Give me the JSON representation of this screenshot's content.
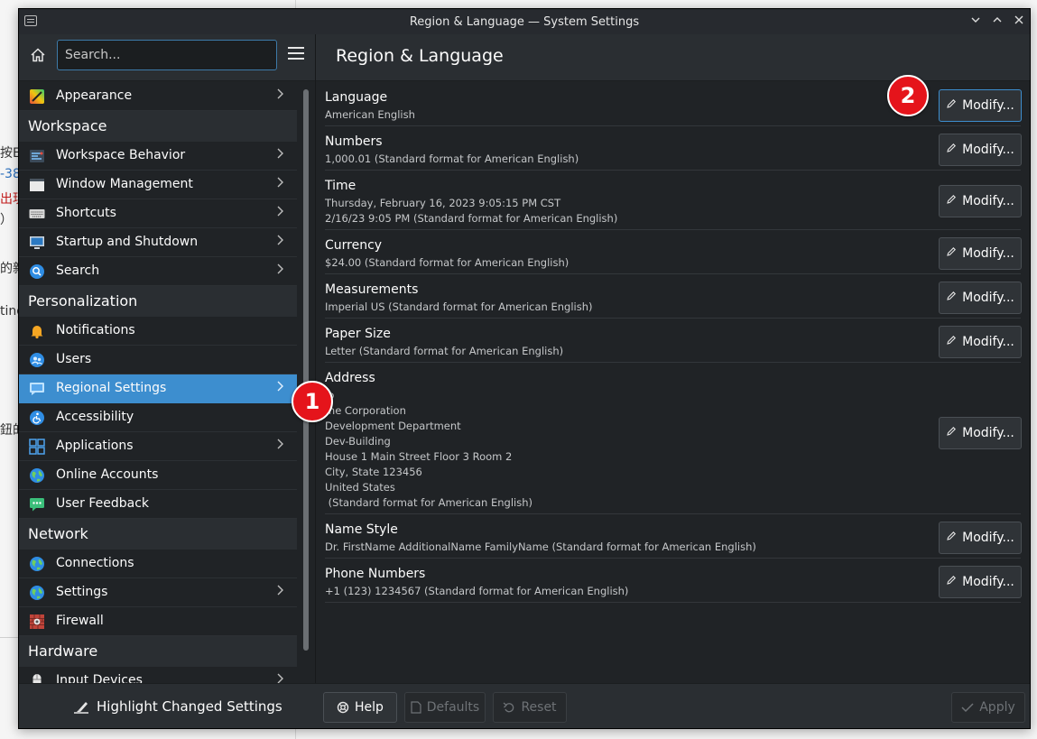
{
  "window": {
    "title": "Region & Language — System Settings"
  },
  "background_fragments": [
    "按E",
    "-38",
    "出現",
    "）",
    "的新",
    "ting",
    "鈕的"
  ],
  "search": {
    "placeholder": "Search..."
  },
  "sidebar": {
    "items": [
      {
        "type": "item",
        "label": "Appearance",
        "icon": "appearance-icon",
        "chevron": true
      },
      {
        "type": "header",
        "label": "Workspace"
      },
      {
        "type": "item",
        "label": "Workspace Behavior",
        "icon": "workspace-behavior-icon",
        "chevron": true
      },
      {
        "type": "item",
        "label": "Window Management",
        "icon": "window-management-icon",
        "chevron": true
      },
      {
        "type": "item",
        "label": "Shortcuts",
        "icon": "keyboard-icon",
        "chevron": true
      },
      {
        "type": "item",
        "label": "Startup and Shutdown",
        "icon": "monitor-icon",
        "chevron": true
      },
      {
        "type": "item",
        "label": "Search",
        "icon": "search-icon",
        "chevron": true
      },
      {
        "type": "header",
        "label": "Personalization"
      },
      {
        "type": "item",
        "label": "Notifications",
        "icon": "bell-icon",
        "chevron": false
      },
      {
        "type": "item",
        "label": "Users",
        "icon": "users-icon",
        "chevron": false
      },
      {
        "type": "item",
        "label": "Regional Settings",
        "icon": "regional-icon",
        "chevron": true,
        "active": true
      },
      {
        "type": "item",
        "label": "Accessibility",
        "icon": "accessibility-icon",
        "chevron": false
      },
      {
        "type": "item",
        "label": "Applications",
        "icon": "applications-icon",
        "chevron": true
      },
      {
        "type": "item",
        "label": "Online Accounts",
        "icon": "globe-icon",
        "chevron": false
      },
      {
        "type": "item",
        "label": "User Feedback",
        "icon": "feedback-icon",
        "chevron": false
      },
      {
        "type": "header",
        "label": "Network"
      },
      {
        "type": "item",
        "label": "Connections",
        "icon": "globe-icon",
        "chevron": false
      },
      {
        "type": "item",
        "label": "Settings",
        "icon": "globe-icon",
        "chevron": true
      },
      {
        "type": "item",
        "label": "Firewall",
        "icon": "firewall-icon",
        "chevron": false
      },
      {
        "type": "header",
        "label": "Hardware"
      },
      {
        "type": "item",
        "label": "Input Devices",
        "icon": "mouse-icon",
        "chevron": true
      }
    ]
  },
  "content": {
    "title": "Region & Language",
    "modify_label": "Modify...",
    "rows": [
      {
        "title": "Language",
        "sub": "American English"
      },
      {
        "title": "Numbers",
        "sub": "1,000.01 (Standard format for American English)"
      },
      {
        "title": "Time",
        "sub": "Thursday, February 16, 2023 9:05:15 PM CST\n2/16/23 9:05 PM (Standard format for American English)"
      },
      {
        "title": "Currency",
        "sub": "$24.00 (Standard format for American English)"
      },
      {
        "title": "Measurements",
        "sub": "Imperial US (Standard format for American English)"
      },
      {
        "title": "Paper Size",
        "sub": "Letter (Standard format for American English)"
      },
      {
        "title": "Address",
        "sub": "Jo\nme Corporation\nDevelopment Department\nDev-Building\nHouse 1 Main Street Floor 3 Room 2\nCity, State 123456\nUnited States\n (Standard format for American English)"
      },
      {
        "title": "Name Style",
        "sub": "Dr. FirstName AdditionalName FamilyName (Standard format for American English)"
      },
      {
        "title": "Phone Numbers",
        "sub": "+1 (123) 1234567 (Standard format for American English)"
      }
    ]
  },
  "bottom": {
    "highlight_label": "Highlight Changed Settings",
    "help_label": "Help",
    "defaults_label": "Defaults",
    "reset_label": "Reset",
    "apply_label": "Apply"
  },
  "badges": {
    "one": "1",
    "two": "2"
  },
  "colors": {
    "accent": "#3d8ecf",
    "badge": "#e5141b"
  }
}
